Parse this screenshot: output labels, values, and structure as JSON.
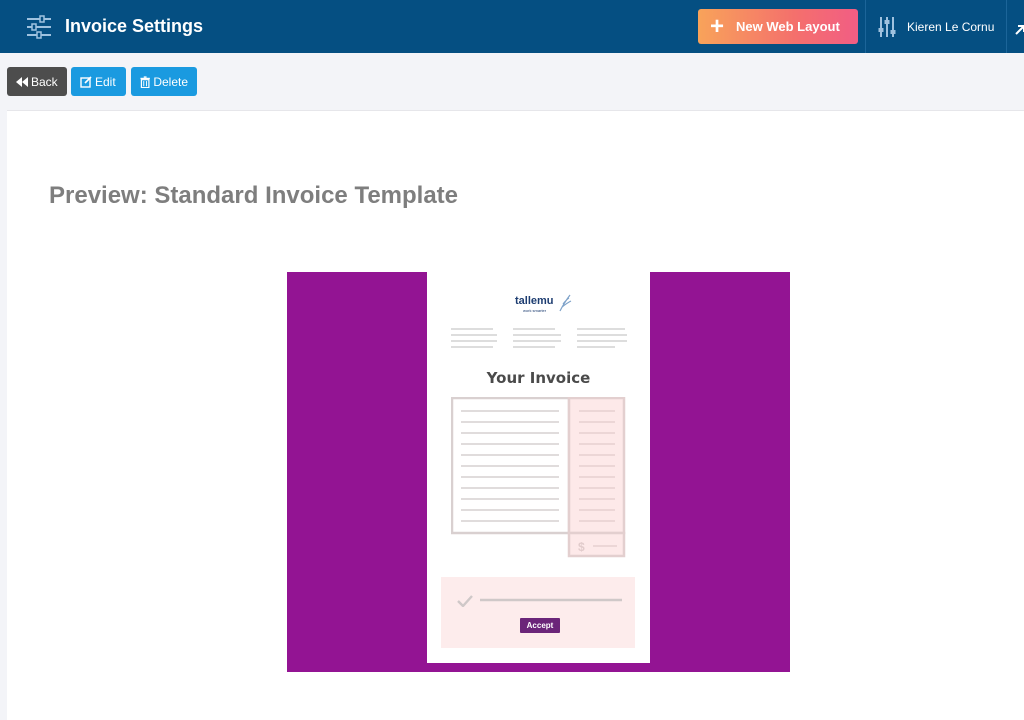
{
  "header": {
    "title": "Invoice Settings",
    "new_layout_label": "New Web Layout",
    "user_name": "Kieren Le Cornu",
    "bg_color": "#054f82"
  },
  "toolbar": {
    "back_label": "Back",
    "edit_label": "Edit",
    "delete_label": "Delete"
  },
  "main": {
    "preview_title": "Preview: Standard Invoice Template",
    "preview": {
      "frame_color": "#931493",
      "logo_name": "tallemu",
      "logo_tagline": "work smarter",
      "doc_title": "Your Invoice",
      "currency_symbol": "$",
      "accept_label": "Accept"
    }
  }
}
